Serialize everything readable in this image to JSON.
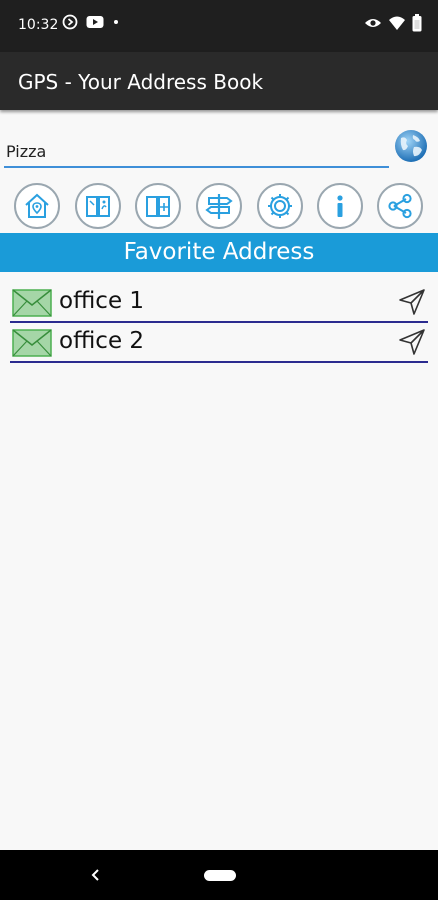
{
  "status_bar": {
    "time": "10:32",
    "left_icons": [
      "media-icon",
      "youtube-icon",
      "dot-icon"
    ],
    "right_icons": [
      "eye-icon",
      "wifi-icon",
      "battery-icon"
    ]
  },
  "app_bar": {
    "title": "GPS - Your Address Book"
  },
  "search": {
    "value": "Pizza"
  },
  "toolbar": {
    "buttons": [
      "home-location-icon",
      "map-book-icon",
      "address-book-icon",
      "signpost-icon",
      "settings-gear-icon",
      "info-icon",
      "share-icon"
    ]
  },
  "favorites": {
    "header": "Favorite Address",
    "items": [
      {
        "name": "office 1"
      },
      {
        "name": "office 2"
      }
    ]
  },
  "colors": {
    "status_bar": "#1f1f1f",
    "app_bar": "#2a2a2a",
    "accent": "#1a9bd8",
    "divider": "#2b2b8f",
    "icon_blue": "#2aa0e0",
    "envelope_green": "#4caf50"
  }
}
